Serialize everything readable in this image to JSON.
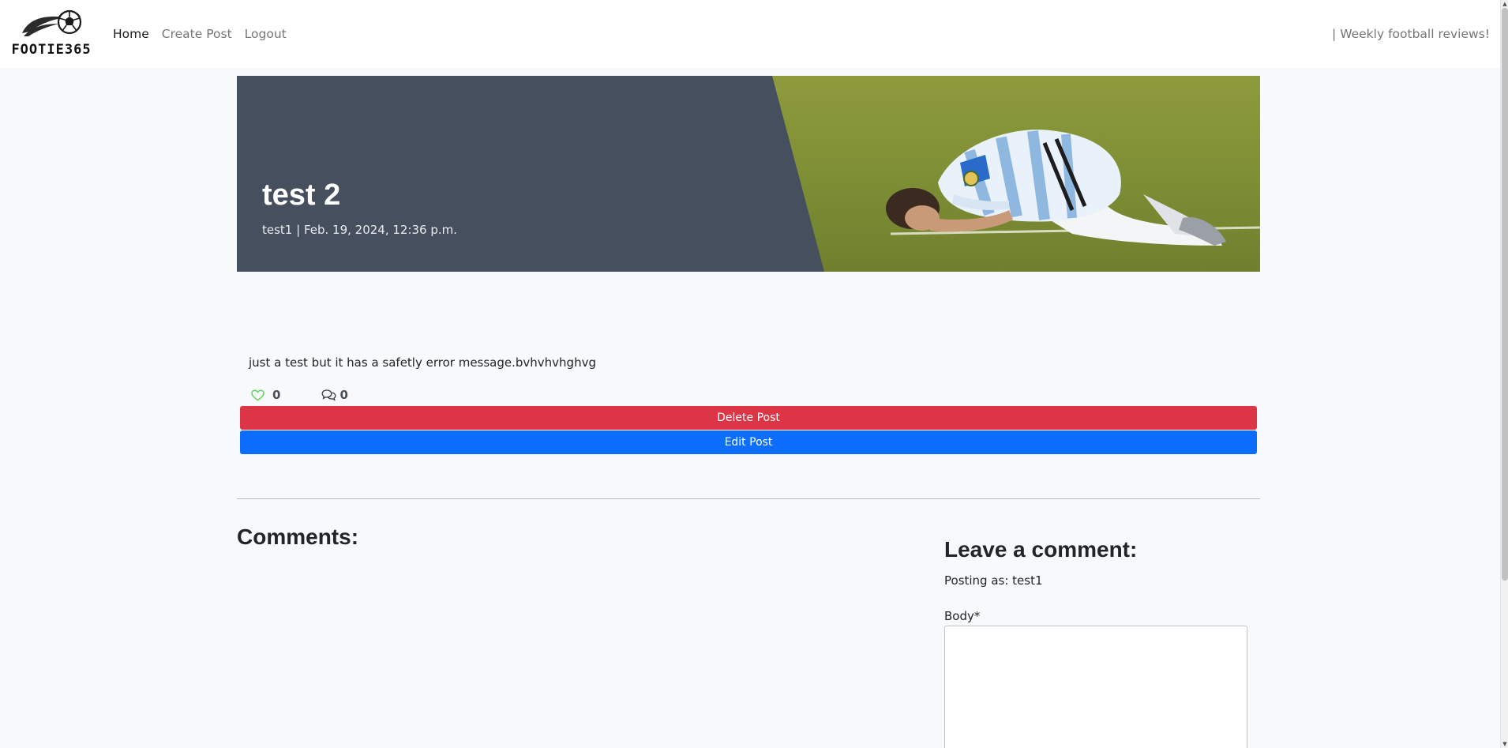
{
  "brand": {
    "name": "FOOTIE365"
  },
  "nav": {
    "links": [
      {
        "label": "Home"
      },
      {
        "label": "Create Post"
      },
      {
        "label": "Logout"
      }
    ],
    "tagline": "| Weekly football reviews!"
  },
  "post": {
    "title": "test 2",
    "meta": "test1 | Feb. 19, 2024, 12:36 p.m.",
    "body": "just a test but it has a safetly error message.bvhvhvhghvg",
    "likes": "0",
    "comments": "0",
    "delete_label": "Delete Post",
    "edit_label": "Edit Post"
  },
  "comments": {
    "heading": "Comments:"
  },
  "comment_form": {
    "heading": "Leave a comment:",
    "posting_as": "Posting as: test1",
    "body_label": "Body*"
  },
  "colors": {
    "hero_bg": "#454f5d",
    "delete": "#dc3545",
    "edit": "#0d6efd",
    "like": "#5cd65c"
  },
  "icons": {
    "like": "heart-icon",
    "comments": "speech-bubbles-icon",
    "logo": "football-logo-icon"
  }
}
